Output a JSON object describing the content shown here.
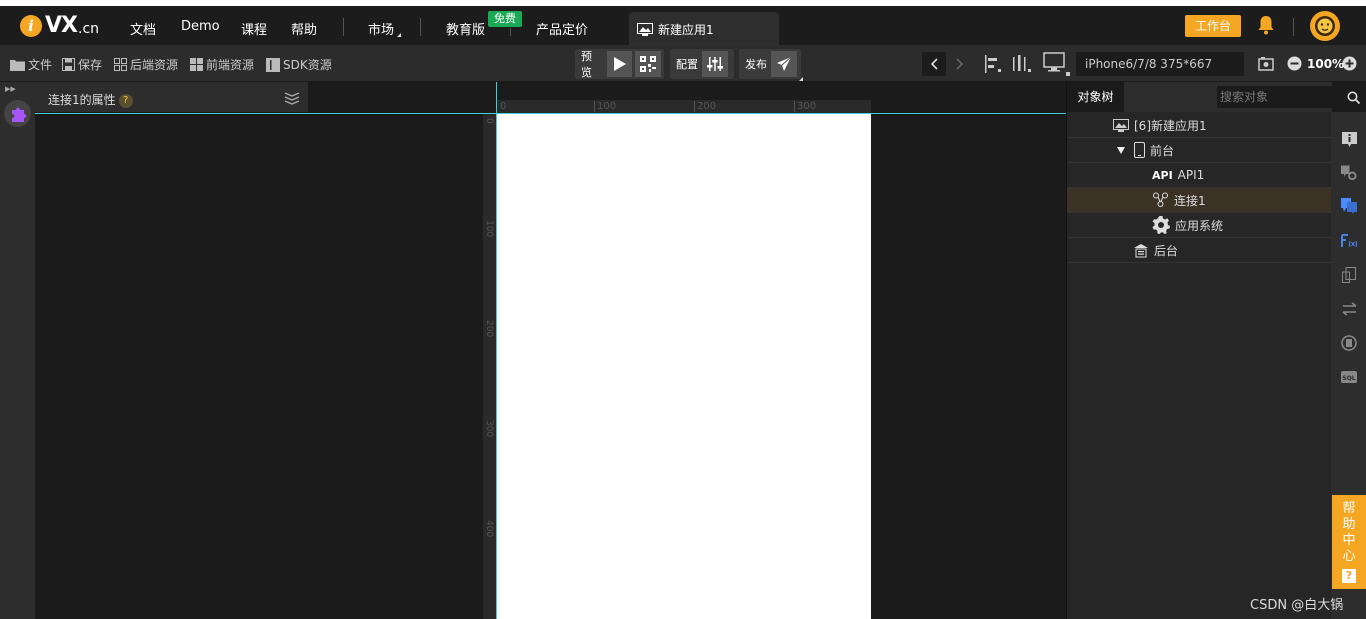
{
  "brand": {
    "logo_letter": "i",
    "logo_text": "VX",
    "logo_suffix": ".cn",
    "color": "#f5a623"
  },
  "nav": {
    "items": [
      "文档",
      "Demo",
      "课程",
      "帮助",
      "市场",
      "教育版",
      "产品定价"
    ],
    "badge": "免费",
    "doc_tab": "新建应用1",
    "workbench": "工作台"
  },
  "toolbar": {
    "file": "文件",
    "save": "保存",
    "backend_res": "后端资源",
    "frontend_res": "前端资源",
    "sdk_res": "SDK资源",
    "preview": "预览",
    "config": "配置",
    "publish": "发布",
    "device": "iPhone6/7/8 375*667",
    "zoom": "100%"
  },
  "props_panel": {
    "title": "连接1的属性",
    "help": "?"
  },
  "ruler": {
    "top": [
      "0",
      "100",
      "200",
      "300"
    ],
    "left": [
      "0",
      "100",
      "200",
      "300",
      "400"
    ]
  },
  "object_tree": {
    "tab": "对象树",
    "search_placeholder": "搜索对象",
    "nodes": [
      {
        "label": "[6]新建应用1",
        "icon": "app-icon"
      },
      {
        "label": "前台",
        "icon": "phone-icon",
        "expanded": true
      },
      {
        "prefix": "API",
        "label": "API1",
        "icon": "api-icon"
      },
      {
        "label": "连接1",
        "icon": "link-icon",
        "selected": true
      },
      {
        "label": "应用系统",
        "icon": "gear-icon"
      },
      {
        "label": "后台",
        "icon": "server-icon"
      }
    ]
  },
  "help_center": {
    "chars": [
      "帮",
      "助",
      "中",
      "心"
    ],
    "q": "?"
  },
  "watermark": "CSDN @白大锅"
}
